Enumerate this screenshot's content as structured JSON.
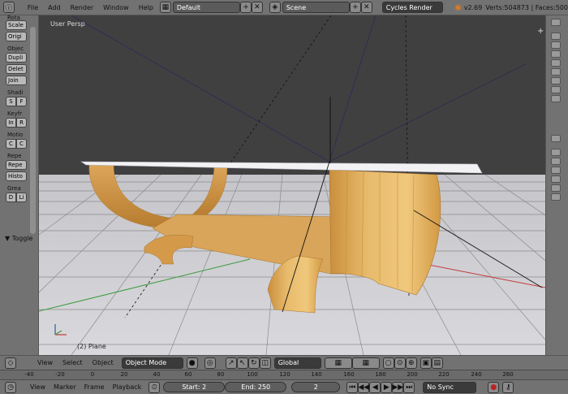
{
  "topbar": {
    "menus": [
      "File",
      "Add",
      "Render",
      "Window",
      "Help"
    ],
    "layout": "Default",
    "scene": "Scene",
    "engine": "Cycles Render",
    "version": "v2.69",
    "stats": "Verts:504873 | Faces:500"
  },
  "toolshelf": {
    "transform_header": "Rota",
    "scale_btn": "Scale",
    "origin_btn": "Origi",
    "object_header": "Objec",
    "duplicate_btn": "Dupli",
    "delete_btn": "Delet",
    "join_btn": "Join",
    "shading_header": "Shadi",
    "shading_smooth": "S",
    "shading_flat": "F",
    "keyframes_header": "Keyfr",
    "insert_btn": "In",
    "remove_btn": "R",
    "motion_header": "Motio",
    "motion_a": "C",
    "motion_b": "C",
    "repeat_header": "Repe",
    "repeat_btn": "Repe",
    "history_btn": "Histo",
    "grease_header": "Grea",
    "grease_draw": "D",
    "grease_line": "Li",
    "toggle_label": "Toggle"
  },
  "viewport": {
    "view_label": "User Persp",
    "object_label": "(2) Plane"
  },
  "view3d_header": {
    "view": "View",
    "select": "Select",
    "object": "Object",
    "mode": "Object Mode",
    "orientation": "Global"
  },
  "ruler": {
    "ticks": [
      "-40",
      "-20",
      "0",
      "20",
      "40",
      "60",
      "80",
      "100",
      "120",
      "140",
      "160",
      "180",
      "200",
      "220",
      "240",
      "260"
    ]
  },
  "timeline": {
    "view": "View",
    "marker": "Marker",
    "frame": "Frame",
    "playback": "Playback",
    "start": "Start: 2",
    "end": "End: 250",
    "current": "2",
    "sync": "No Sync"
  },
  "colors": {
    "wood": "#e3b56a",
    "floor": "#d2d2d6",
    "grid": "#8a8a8a",
    "x_axis": "#c23a3a",
    "y_axis": "#3c9a3c",
    "background": "#3f3f3f"
  }
}
